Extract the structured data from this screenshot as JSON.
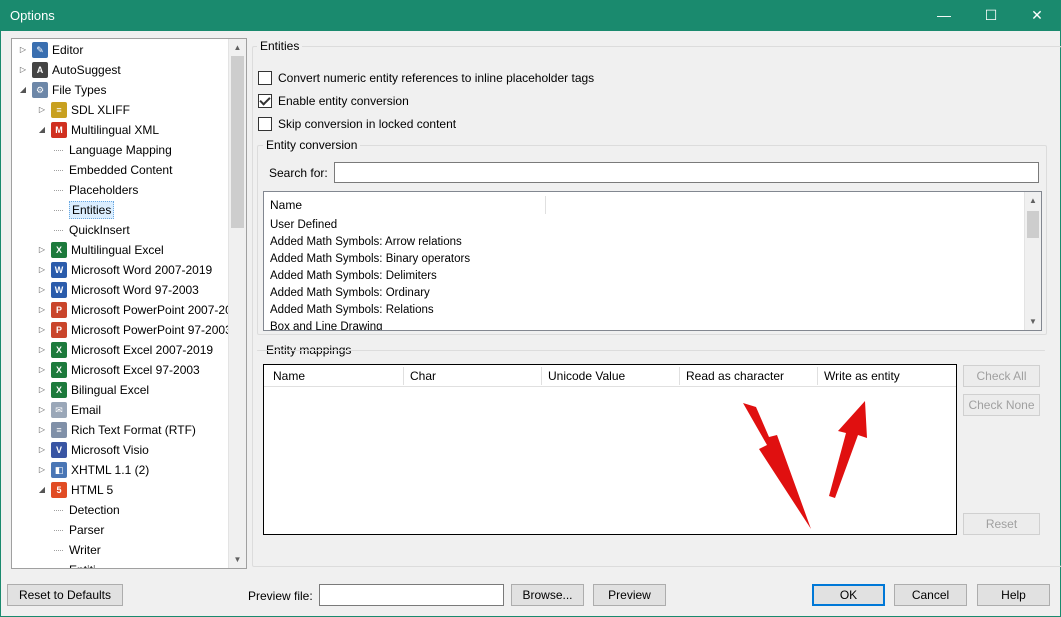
{
  "window": {
    "title": "Options",
    "minimize": "—",
    "maximize": "☐",
    "close": "✕"
  },
  "tree": {
    "items": [
      {
        "label": "Editor",
        "icon": "pencil-icon"
      },
      {
        "label": "AutoSuggest",
        "icon": "autosuggest-icon"
      },
      {
        "label": "File Types",
        "icon": "gear-icon"
      },
      {
        "label": "SDL XLIFF",
        "icon": "xliff-icon"
      },
      {
        "label": "Multilingual XML",
        "icon": "multilingual-xml-icon"
      },
      {
        "label": "Language Mapping",
        "icon": ""
      },
      {
        "label": "Embedded Content",
        "icon": ""
      },
      {
        "label": "Placeholders",
        "icon": ""
      },
      {
        "label": "Entities",
        "icon": ""
      },
      {
        "label": "QuickInsert",
        "icon": ""
      },
      {
        "label": "Multilingual Excel",
        "icon": "excel-icon"
      },
      {
        "label": "Microsoft Word 2007-2019",
        "icon": "word-icon"
      },
      {
        "label": "Microsoft Word 97-2003",
        "icon": "word-icon"
      },
      {
        "label": "Microsoft PowerPoint 2007-20",
        "icon": "powerpoint-icon"
      },
      {
        "label": "Microsoft PowerPoint 97-2003",
        "icon": "powerpoint-icon"
      },
      {
        "label": "Microsoft Excel 2007-2019",
        "icon": "excel-icon"
      },
      {
        "label": "Microsoft Excel 97-2003",
        "icon": "excel-icon"
      },
      {
        "label": "Bilingual Excel",
        "icon": "excel-icon"
      },
      {
        "label": "Email",
        "icon": "email-icon"
      },
      {
        "label": "Rich Text Format (RTF)",
        "icon": "rtf-icon"
      },
      {
        "label": "Microsoft Visio",
        "icon": "visio-icon"
      },
      {
        "label": "XHTML 1.1 (2)",
        "icon": "xhtml-icon"
      },
      {
        "label": "HTML 5",
        "icon": "html5-icon"
      },
      {
        "label": "Detection",
        "icon": ""
      },
      {
        "label": "Parser",
        "icon": ""
      },
      {
        "label": "Writer",
        "icon": ""
      },
      {
        "label": "Entiti...",
        "icon": ""
      }
    ]
  },
  "entities": {
    "section_title": "Entities",
    "options": [
      {
        "label": "Convert numeric entity references to inline placeholder tags",
        "checked": false
      },
      {
        "label": "Enable entity conversion",
        "checked": true
      },
      {
        "label": "Skip conversion in locked content",
        "checked": false
      }
    ],
    "conversion": {
      "title": "Entity conversion",
      "search_label": "Search for:",
      "search_value": "",
      "list_header": "Name",
      "list_items": [
        "User Defined",
        "Added Math Symbols: Arrow relations",
        "Added Math Symbols: Binary operators",
        "Added Math Symbols: Delimiters",
        "Added Math Symbols: Ordinary",
        "Added Math Symbols: Relations",
        "Box and Line Drawing"
      ]
    },
    "mappings": {
      "title": "Entity mappings",
      "columns": [
        "Name",
        "Char",
        "Unicode Value",
        "Read as character",
        "Write as entity"
      ],
      "check_all": "Check All",
      "check_none": "Check None",
      "reset": "Reset"
    }
  },
  "footer": {
    "reset_defaults": "Reset to Defaults",
    "preview_file_label": "Preview file:",
    "preview_file_value": "",
    "browse": "Browse...",
    "preview": "Preview",
    "ok": "OK",
    "cancel": "Cancel",
    "help": "Help"
  },
  "annotation_color": "#e01010"
}
